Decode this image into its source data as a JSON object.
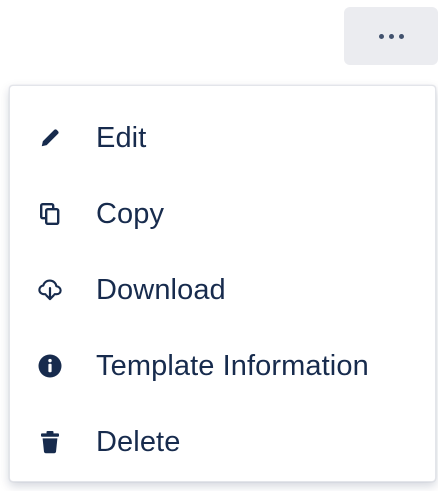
{
  "more_button": {
    "icon": "more-horizontal-icon"
  },
  "menu": {
    "items": [
      {
        "label": "Edit",
        "icon": "pencil-icon"
      },
      {
        "label": "Copy",
        "icon": "copy-icon"
      },
      {
        "label": "Download",
        "icon": "cloud-download-icon"
      },
      {
        "label": "Template Information",
        "icon": "info-circle-icon"
      },
      {
        "label": "Delete",
        "icon": "trash-icon"
      }
    ]
  },
  "colors": {
    "text": "#172b4d",
    "button_bg": "#ebecf0",
    "icon": "#172b4d"
  }
}
